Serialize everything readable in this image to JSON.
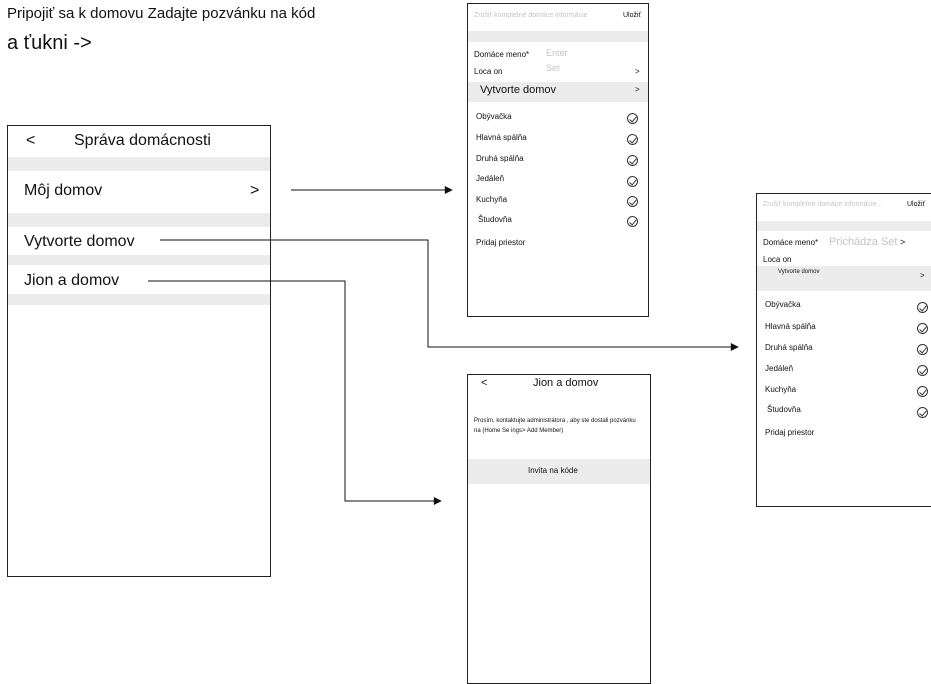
{
  "instruction": {
    "line1": "Pripojiť sa k domovu Zadajte pozvánku na kód",
    "line2": "a ťukni ->"
  },
  "screen_manage": {
    "back": "<",
    "title": "Správa domácnosti",
    "items": [
      {
        "label": "Môj domov",
        "chevron": ">"
      },
      {
        "label": "Vytvorte domov"
      },
      {
        "label": "Jion a domov"
      }
    ]
  },
  "screen_create_top": {
    "cancel": "Zrušiť kompletné domáce informácie",
    "save": "Uložiť",
    "name_label": "Domáce meno*",
    "name_placeholder": "Enter",
    "location_label": "Loca on",
    "location_value": "Set",
    "location_chevron": ">",
    "create_label": "Vytvorte domov",
    "create_chevron": ">",
    "rooms": [
      "Obývačka",
      "Hlavná spálňa",
      "Druhá spálňa",
      "Jedáleň",
      "Kuchyňa",
      "Študovňa"
    ],
    "add_room": "Pridaj priestor"
  },
  "screen_create_right": {
    "cancel": "Zrušiť kompletné domáce informácie...",
    "save": "Uložiť",
    "name_label": "Domáce meno*",
    "name_placeholder": "Prichádza Set",
    "name_chevron": ">",
    "location_label": "Loca on",
    "create_label": "Vytvorte domov",
    "create_chevron": ">",
    "rooms": [
      "Obývačka",
      "Hlavná spálňa",
      "Druhá spálňa",
      "Jedáleň",
      "Kuchyňa",
      "Študovňa"
    ],
    "add_room": "Pridaj priestor"
  },
  "screen_join": {
    "back": "<",
    "title": "Jion a domov",
    "message": "Prosím, kontaktujte administrátora , aby ste dostali pozvánku na (Home Se ings> Add Member)",
    "invite_button": "Invita na kóde"
  },
  "icons": {
    "check": "check-circle-icon",
    "arrow": "arrow-right-icon"
  }
}
